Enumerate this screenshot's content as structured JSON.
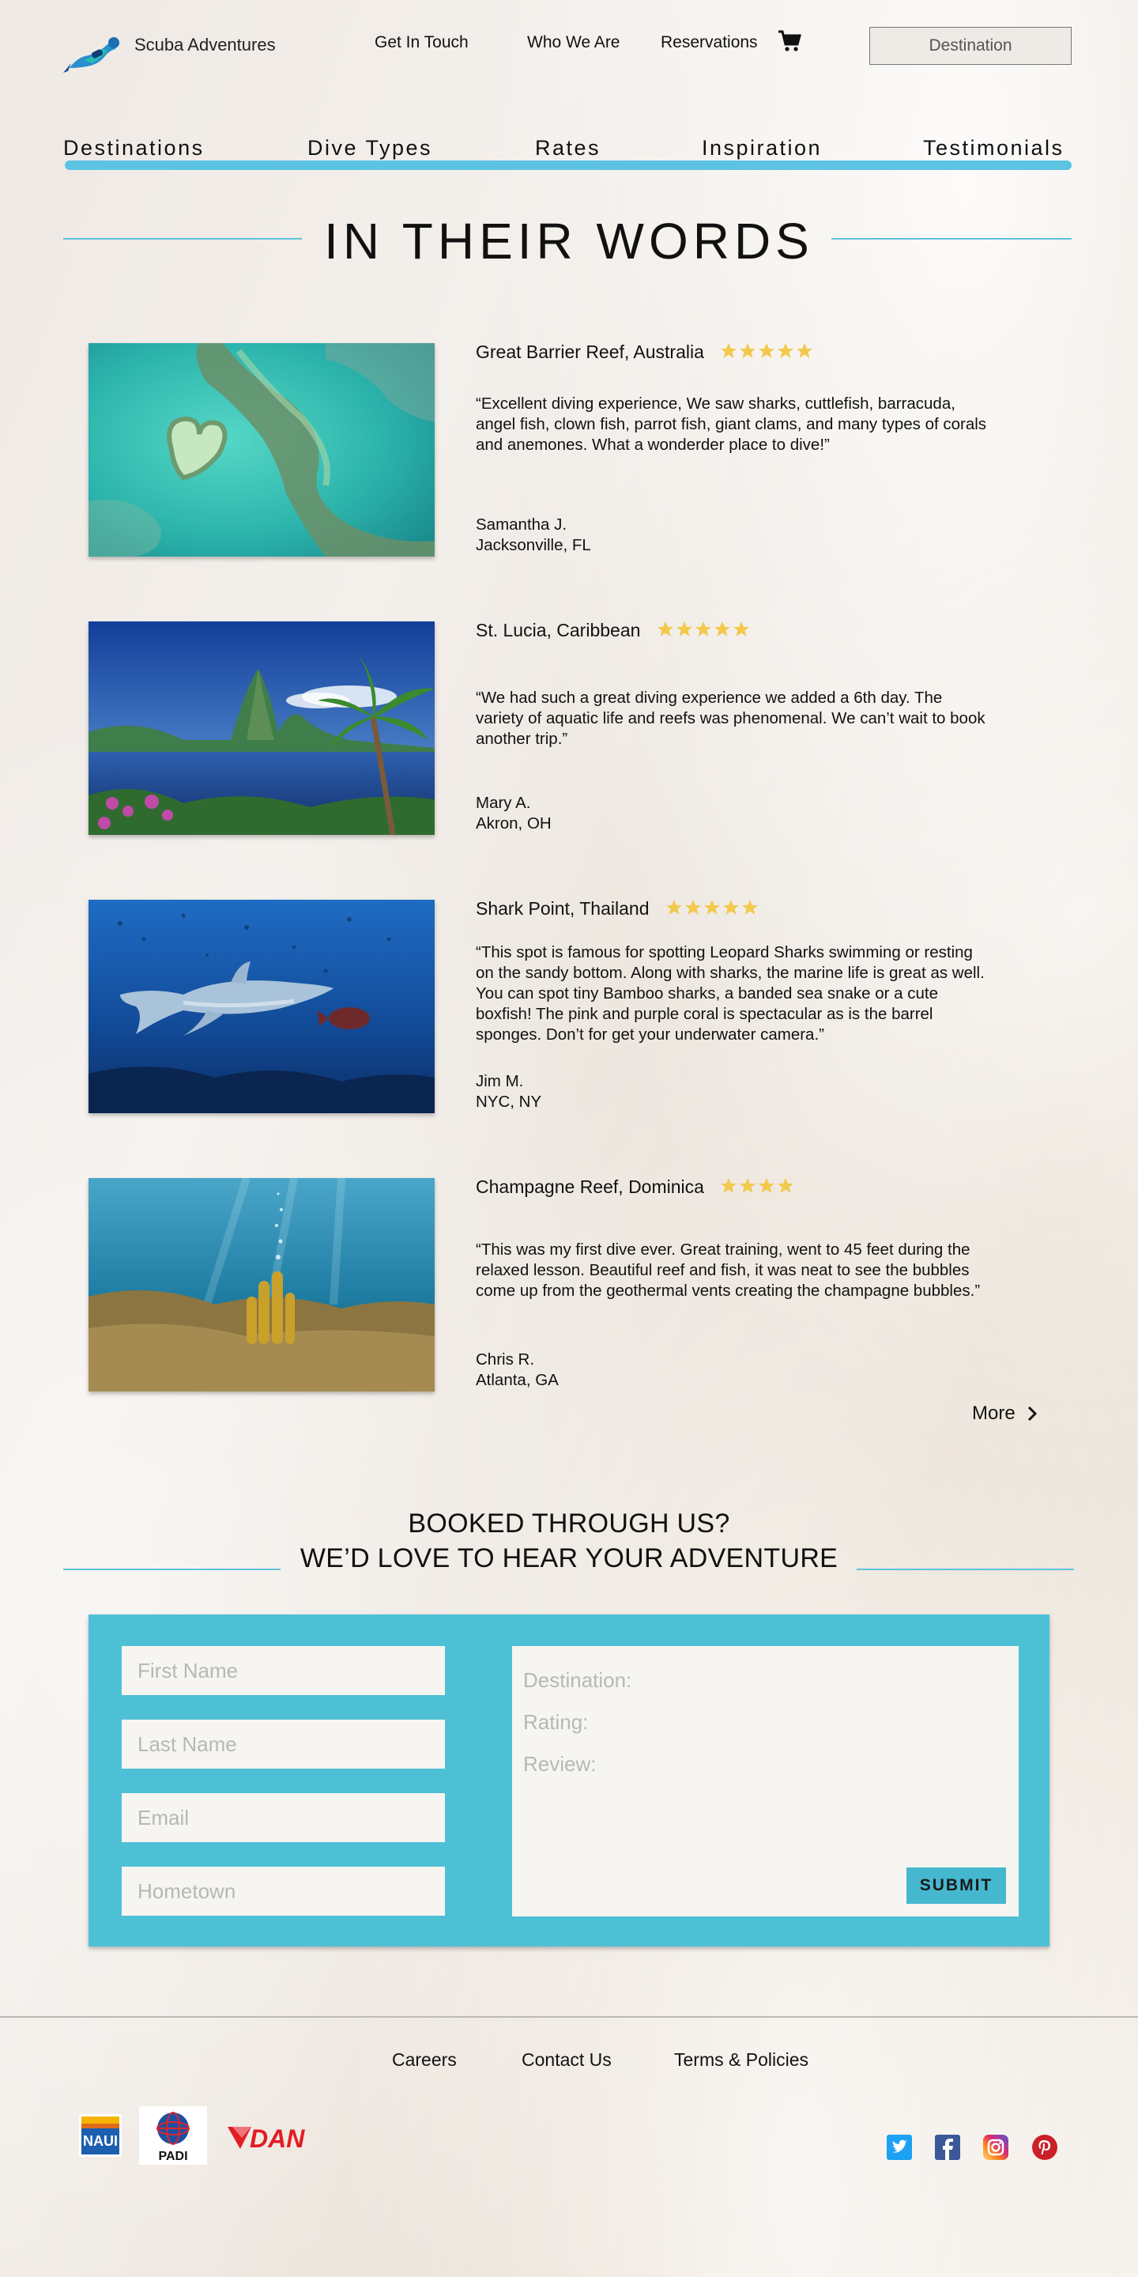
{
  "header": {
    "brand": "Scuba Adventures",
    "links": [
      "Get In Touch",
      "Who We Are",
      "Reservations"
    ],
    "destination_button": "Destination"
  },
  "main_nav": [
    "Destinations",
    "Dive Types",
    "Rates",
    "Inspiration",
    "Testimonials"
  ],
  "section_title": "IN THEIR WORDS",
  "testimonials": [
    {
      "title": "Great Barrier Reef, Australia",
      "rating": 5,
      "quote": "“Excellent diving experience, We saw sharks, cuttlefish, barracuda, angel fish, clown fish, parrot fish, giant clams, and many types of corals and anemones. What a wonderder place to dive!”",
      "name": "Samantha J.",
      "city": "Jacksonville, FL"
    },
    {
      "title": "St. Lucia, Caribbean",
      "rating": 5,
      "quote": "“We had such a great diving experience we added a 6th day. The variety of aquatic life and reefs was phenomenal. We can’t wait to book another trip.”",
      "name": "Mary A.",
      "city": "Akron, OH"
    },
    {
      "title": "Shark Point, Thailand",
      "rating": 5,
      "quote": "“This spot is famous for spotting Leopard Sharks swimming or resting on the sandy bottom. Along with sharks, the marine life is great as well. You can spot tiny Bamboo sharks, a banded sea snake or a cute boxfish! The pink and purple coral is spectacular as is the barrel sponges. Don’t for get your underwater camera.”",
      "name": "Jim M.",
      "city": "NYC, NY"
    },
    {
      "title": "Champagne Reef, Dominica",
      "rating": 4,
      "quote": "“This was my first dive ever. Great training, went to 45 feet during the relaxed lesson. Beautiful reef and fish, it was neat to see the bubbles come up from the geothermal vents creating the champagne bubbles.”",
      "name": "Chris R.",
      "city": "Atlanta, GA"
    }
  ],
  "more_link": "More",
  "booking": {
    "line1": "BOOKED THROUGH US?",
    "line2": "WE’D LOVE TO HEAR YOUR ADVENTURE",
    "first_name_placeholder": "First Name",
    "last_name_placeholder": "Last Name",
    "email_placeholder": "Email",
    "hometown_placeholder": "Hometown",
    "destination_label": "Destination:",
    "rating_label": "Rating:",
    "review_label": "Review:",
    "submit": "SUBMIT"
  },
  "footer": {
    "links": [
      "Careers",
      "Contact Us",
      "Terms & Policies"
    ],
    "partners": [
      "NAUI",
      "PADI",
      "DAN"
    ]
  },
  "colors": {
    "accent": "#5cc3e3",
    "form_panel": "#4ec0d6",
    "star": "#f2c94c"
  }
}
